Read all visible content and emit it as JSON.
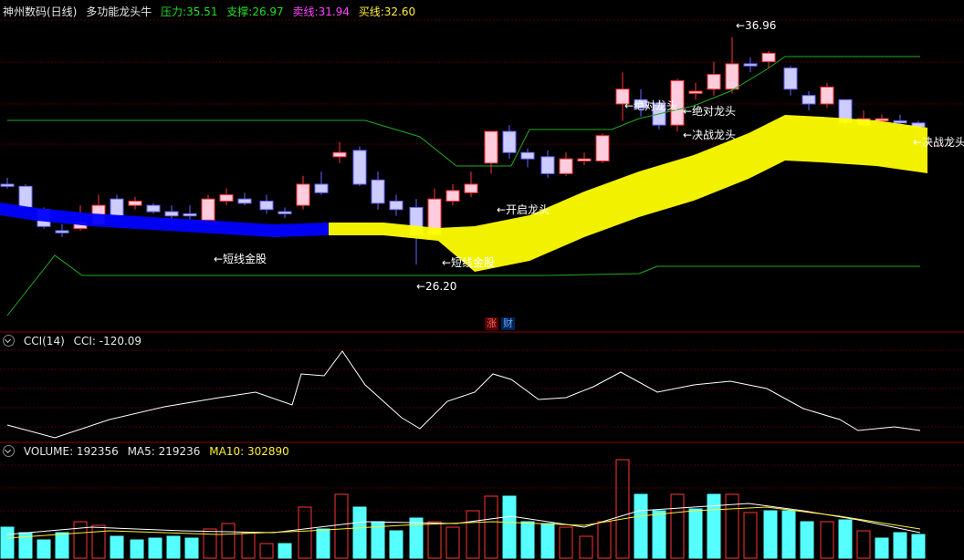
{
  "header": {
    "title": "神州数码(日线)",
    "indicator": "多功能龙头牛",
    "pressure_label": "压力:",
    "pressure_value": "35.51",
    "support_label": "支撑:",
    "support_value": "26.97",
    "sell_label": "卖线:",
    "sell_value": "31.94",
    "buy_label": "买线:",
    "buy_value": "32.60"
  },
  "cci_header": {
    "name": "CCI(14)",
    "value_label": "CCI: -120.09"
  },
  "vol_header": {
    "volume": "VOLUME: 192356",
    "ma5": "MA5: 219236",
    "ma10": "MA10: 302890"
  },
  "tags": {
    "zhang": "涨",
    "cai": "财"
  },
  "annotations": {
    "high": "36.96",
    "low": "26.20",
    "short_gold_1": "短线金股",
    "short_gold_2": "短线金股",
    "absolute_1": "绝对龙头",
    "absolute_2": "绝对龙头",
    "decisive_1": "决战龙头",
    "decisive_2": "决战龙头",
    "open_dragon": "开启龙头"
  },
  "colors": {
    "up": "#ff3333",
    "down": "#3333ff",
    "doji_white": "#ffffff",
    "band_yellow": "#ffff00",
    "band_blue": "#0000ff",
    "line_green": "#22aa22",
    "grid_red": "#aa0000",
    "vol_cyan": "#55ffff",
    "ma_yellow": "#ffee33"
  }
}
